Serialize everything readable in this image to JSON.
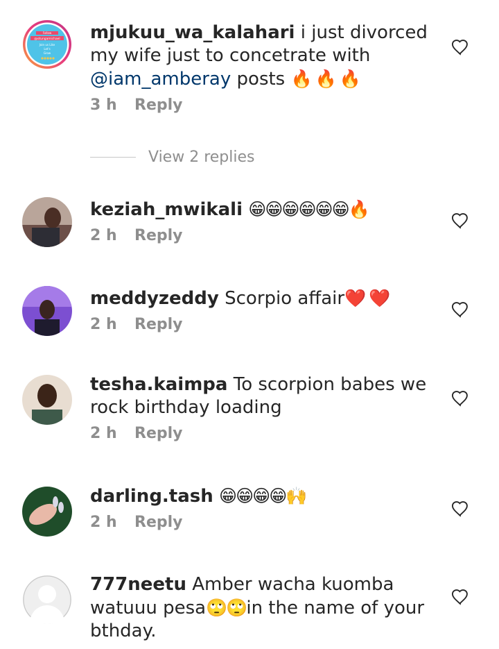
{
  "comments": [
    {
      "username": "mjukuu_wa_kalahari",
      "text_before": " i just divorced my wife just to concetrate with ",
      "mention": "@iam_amberay",
      "text_after": " posts ",
      "emoji": "🔥 🔥 🔥",
      "time": "3 h",
      "reply_label": "Reply",
      "avatar_text": [
        "Follow",
        "@otungamichael",
        "Join us Like",
        "Let's",
        "Grow"
      ]
    },
    {
      "username": "keziah_mwikali",
      "text": " ",
      "emoji": "😁😁😁😁😁😁🔥",
      "time": "2 h",
      "reply_label": "Reply"
    },
    {
      "username": "meddyzeddy",
      "text": " Scorpio affair",
      "emoji": "❤️ ❤️",
      "time": "2 h",
      "reply_label": "Reply"
    },
    {
      "username": "tesha.kaimpa",
      "text": " To scorpion  babes we rock birthday  loading",
      "emoji": "",
      "time": "2 h",
      "reply_label": "Reply"
    },
    {
      "username": "darling.tash",
      "text": " ",
      "emoji": "😁😁😁😁🙌",
      "time": "2 h",
      "reply_label": "Reply"
    },
    {
      "username": "777neetu",
      "text_before": " Amber wacha kuomba watuuu pesa",
      "emoji": "🙄🙄",
      "text_after": "in the name of your bthday."
    }
  ],
  "view_replies_label": "View 2 replies",
  "colors": {
    "mention": "#00376b",
    "meta": "#8e8e8e",
    "text": "#262626"
  },
  "icons": {
    "like": "heart-outline-icon"
  }
}
